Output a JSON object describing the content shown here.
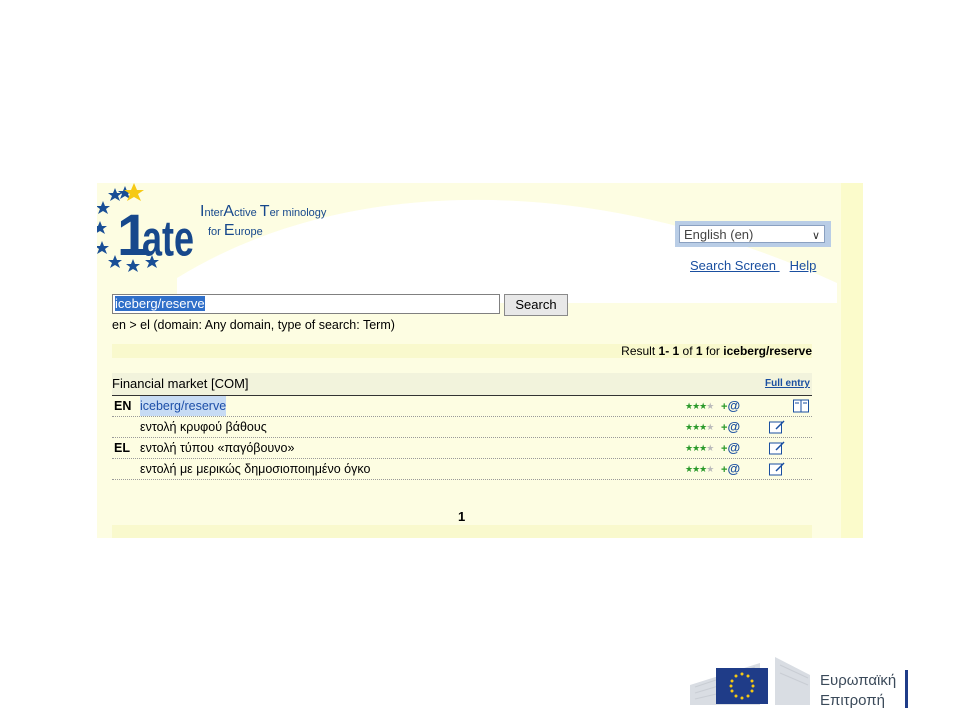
{
  "brand": {
    "line1_letters": [
      "I",
      "nter",
      "A",
      "ctive ",
      "T",
      "er minology"
    ],
    "line2_letters": [
      "for ",
      "E",
      "urope"
    ]
  },
  "language_select": {
    "value": "English (en)"
  },
  "links": {
    "search_screen": "Search Screen ",
    "help": "Help"
  },
  "search": {
    "query": "iceberg/reserve",
    "button": "Search",
    "info": "en > el (domain: Any domain, type of search: Term)"
  },
  "result": {
    "prefix": "Result ",
    "range": "1- 1",
    "of": " of ",
    "total": "1",
    "for": " for ",
    "query": "iceberg/reserve"
  },
  "entry": {
    "domain": "Financial market [COM]",
    "full_entry": "Full entry",
    "rows": [
      {
        "lang": "EN",
        "term": "iceberg/reserve",
        "highlight": true,
        "icon": "book-icon"
      },
      {
        "lang": "",
        "term": "εντολή κρυφού βάθους",
        "highlight": false,
        "icon": "edit-icon"
      },
      {
        "lang": "EL",
        "term": "εντολή τύπου «παγόβουνο»",
        "highlight": false,
        "icon": "edit-icon"
      },
      {
        "lang": "",
        "term": "εντολή με μερικώς δημοσιοποιημένο όγκο",
        "highlight": false,
        "icon": "edit-icon"
      }
    ]
  },
  "pagination": {
    "current": "1"
  },
  "eu": {
    "line1": "Ευρωπαϊκή",
    "line2": "Επιτροπή"
  },
  "colors": {
    "iate_blue": "#17488c",
    "panel_yellow": "#fdfde2",
    "link_blue": "#1a4fa0",
    "star_green": "#2a9a2a"
  }
}
